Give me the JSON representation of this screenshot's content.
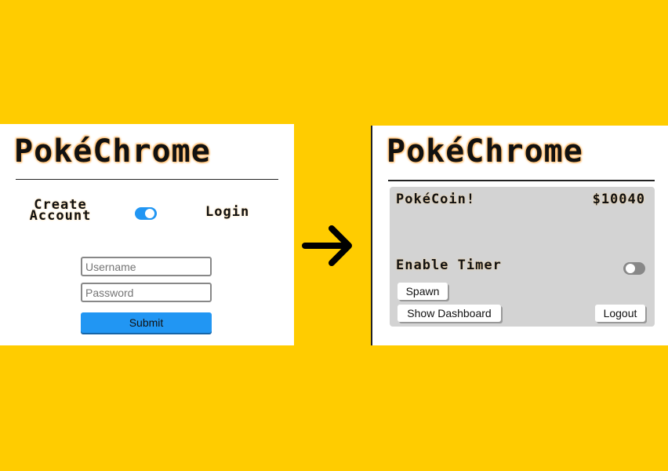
{
  "login_screen": {
    "logo_text": "PokéChrome",
    "create_account_label": "Create Account",
    "login_label": "Login",
    "mode_toggle_on": true,
    "username_placeholder": "Username",
    "password_placeholder": "Password",
    "submit_label": "Submit"
  },
  "dashboard_screen": {
    "logo_text": "PokéChrome",
    "coin_label": "PokéCoin!",
    "coin_value": "$10040",
    "timer_label": "Enable Timer",
    "timer_toggle_on": false,
    "spawn_label": "Spawn",
    "show_dashboard_label": "Show Dashboard",
    "logout_label": "Logout"
  },
  "colors": {
    "background": "#FFCC00",
    "accent": "#2196F3",
    "panel_fill": "#d3d3d3"
  },
  "icons": {
    "transition": "right-arrow-icon"
  }
}
